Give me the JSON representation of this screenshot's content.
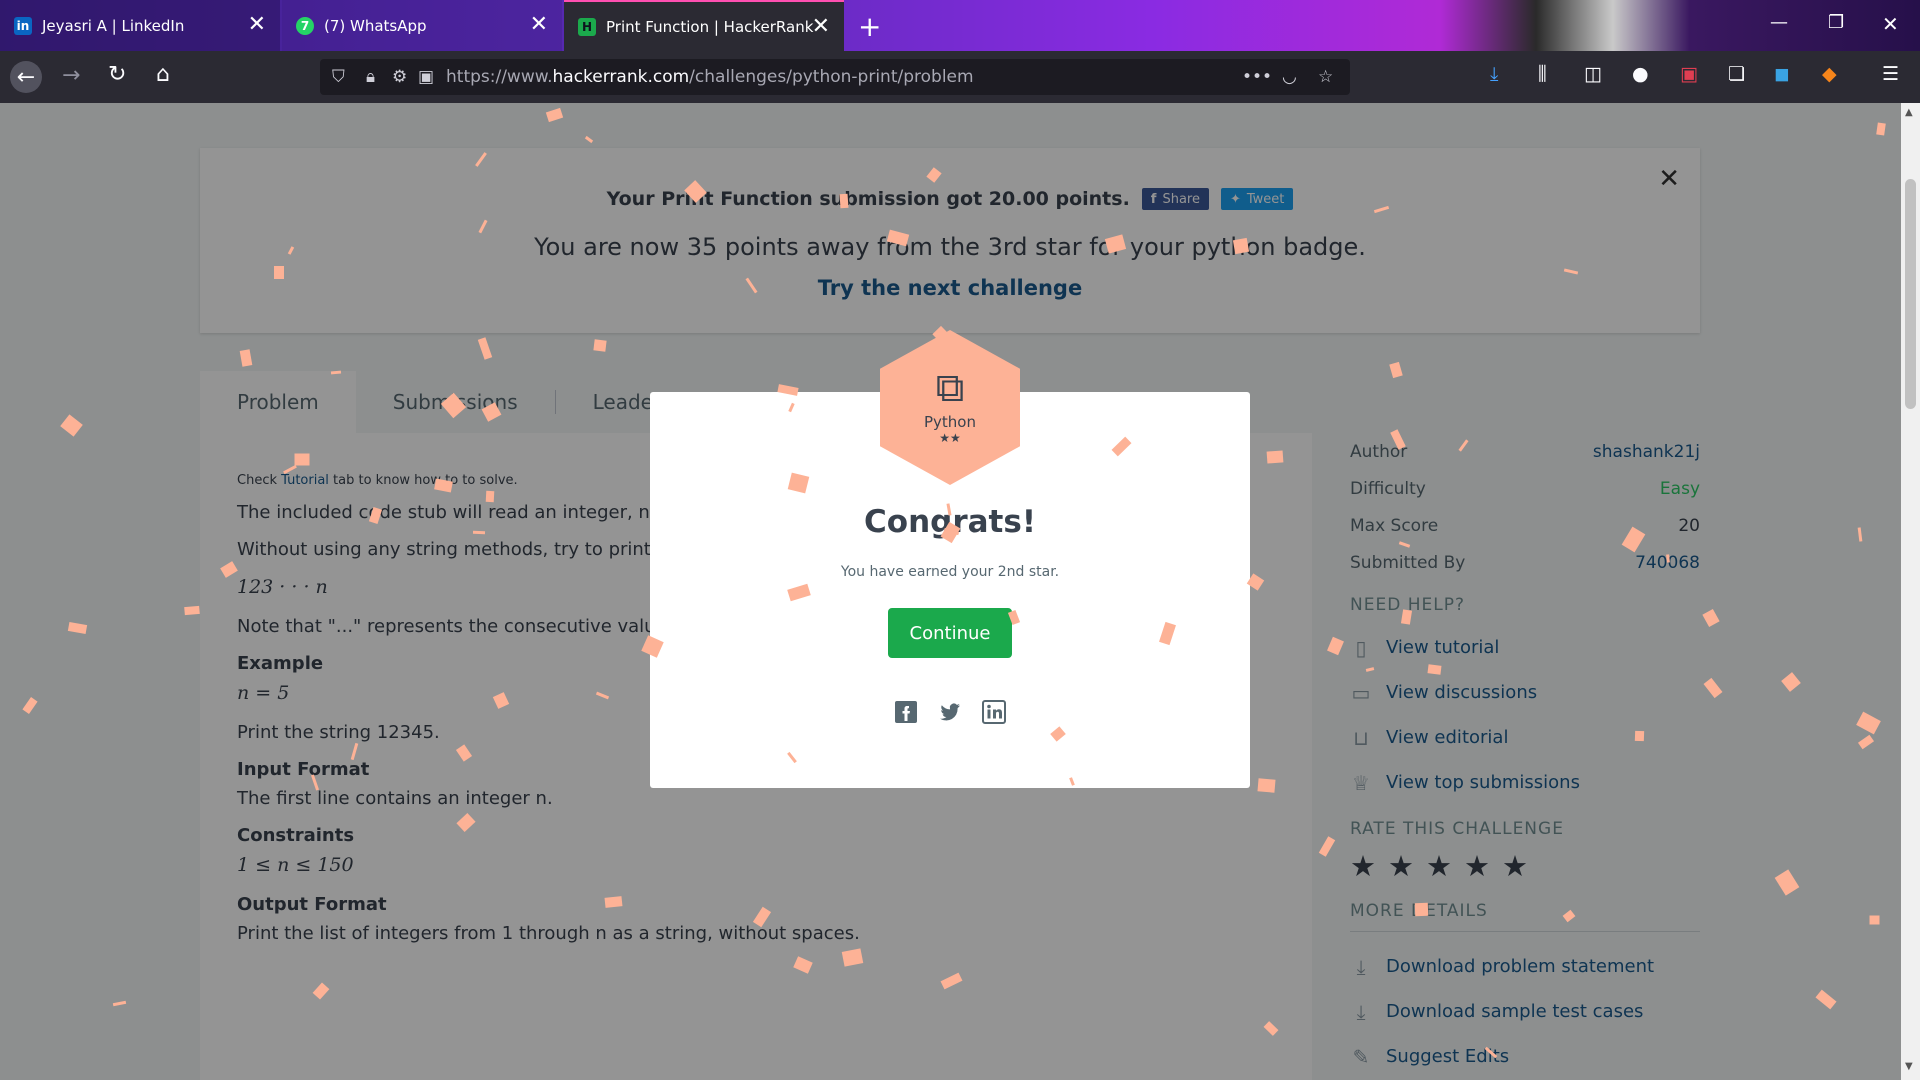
{
  "browser": {
    "tabs": [
      {
        "title": "Jeyasri A | LinkedIn",
        "favicon": "in"
      },
      {
        "title": "(7) WhatsApp",
        "favicon": "7"
      },
      {
        "title": "Print Function | HackerRank",
        "favicon": "H"
      }
    ],
    "url_prefix": "https://www.",
    "url_host": "hackerrank.com",
    "url_path": "/challenges/python-print/problem"
  },
  "banner": {
    "submission_text": "Your Print Function submission got 20.00 points.",
    "share_label": "Share",
    "tweet_label": "Tweet",
    "progress_text": "You are now 35 points away from the 3rd star for your python badge.",
    "next_link": "Try the next challenge"
  },
  "tabs": [
    "Problem",
    "Submissions",
    "Leaderboard"
  ],
  "problem": {
    "hint_prefix": "Check ",
    "hint_link": "Tutorial",
    "hint_suffix": " tab to know how to to solve.",
    "p1": "The included code stub will read an integer, n, from",
    "p2": "Without using any string methods, try to print the f",
    "math1": "123 · · · n",
    "p3": "Note that \"...\" represents the consecutive values i",
    "example_heading": "Example",
    "example_math": "n = 5",
    "example_text": "Print the string 12345.",
    "input_heading": "Input Format",
    "input_text": "The first line contains an integer n.",
    "constraints_heading": "Constraints",
    "constraints_math": "1 ≤ n ≤ 150",
    "output_heading": "Output Format",
    "output_text": "Print the list of integers from 1 through n as a string, without spaces."
  },
  "sidebar": {
    "meta": [
      {
        "label": "Author",
        "value": "shashank21j"
      },
      {
        "label": "Difficulty",
        "value": "Easy"
      },
      {
        "label": "Max Score",
        "value": "20"
      },
      {
        "label": "Submitted By",
        "value": "740068"
      }
    ],
    "need_help_heading": "NEED HELP?",
    "help_items": [
      "View tutorial",
      "View discussions",
      "View editorial",
      "View top submissions"
    ],
    "rate_heading": "RATE THIS CHALLENGE",
    "more_heading": "MORE DETAILS",
    "more_items": [
      "Download problem statement",
      "Download sample test cases",
      "Suggest Edits"
    ]
  },
  "modal": {
    "badge_label": "Python",
    "badge_stars": "★★",
    "title": "Congrats!",
    "subtitle": "You have earned your 2nd star.",
    "continue_label": "Continue"
  },
  "colors": {
    "accent_green": "#1ba94c",
    "link_blue": "#1a5b8e",
    "confetti": "#fdb296",
    "badge": "#fdb296"
  }
}
